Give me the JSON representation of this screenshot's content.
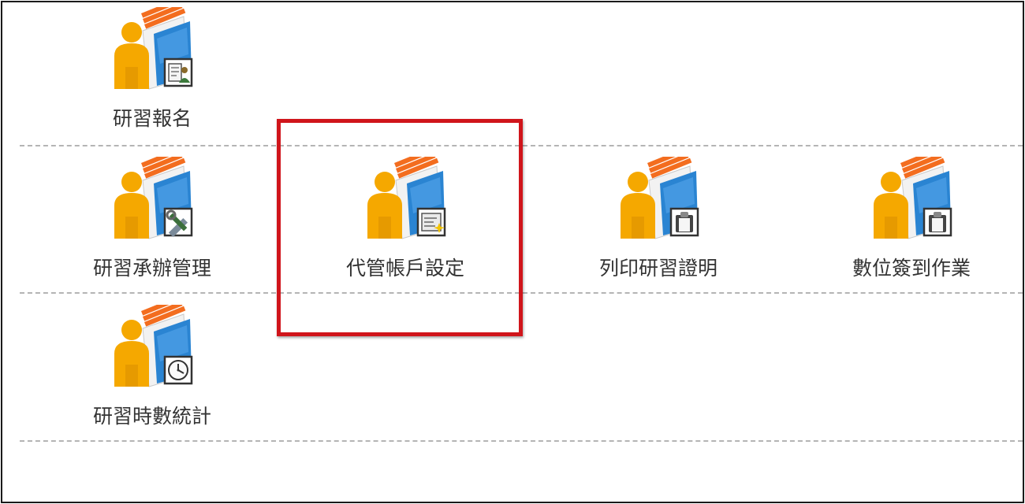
{
  "menu": {
    "items": [
      {
        "label": "研習報名",
        "badge": "form-person"
      },
      {
        "label": "研習承辦管理",
        "badge": "tools"
      },
      {
        "label": "代管帳戶設定",
        "badge": "settings-sparkle"
      },
      {
        "label": "列印研習證明",
        "badge": "clipboard"
      },
      {
        "label": "數位簽到作業",
        "badge": "clipboard"
      },
      {
        "label": "研習時數統計",
        "badge": "clock"
      }
    ]
  },
  "colors": {
    "highlight": "#d0151b",
    "divider": "#b4b4b4",
    "person": "#f5a800",
    "book_blue": "#2a84d2",
    "page_stripe": "#f36d1f"
  }
}
